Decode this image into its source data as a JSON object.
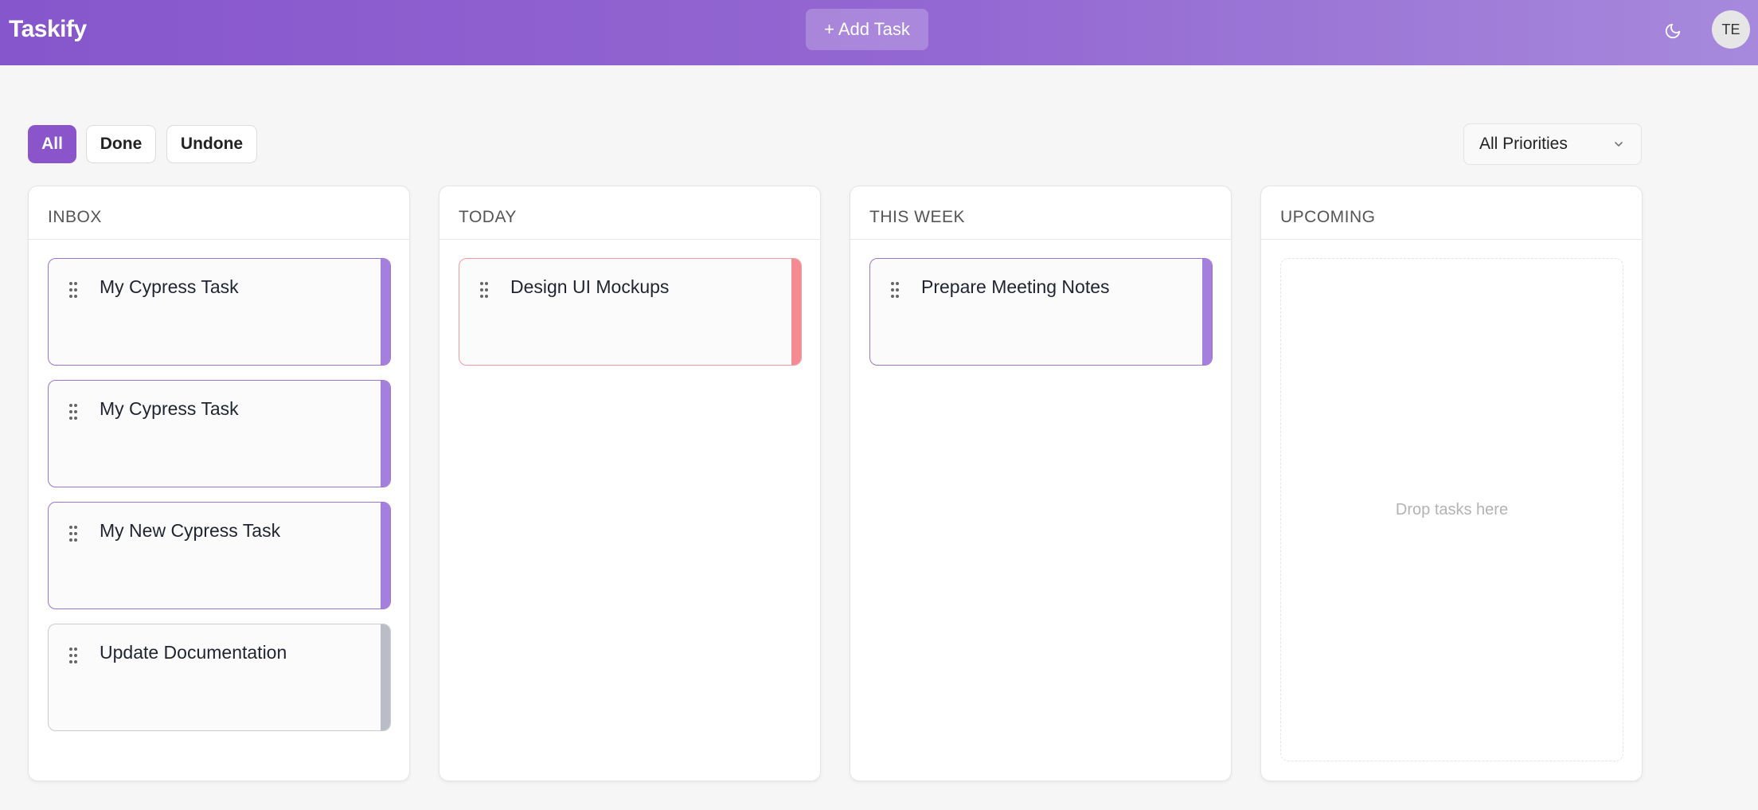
{
  "app": {
    "brand": "Taskify",
    "add_task_label": "+ Add Task",
    "avatar_initials": "TE"
  },
  "filters": {
    "all": "All",
    "done": "Done",
    "undone": "Undone",
    "active": "All"
  },
  "priority_select": {
    "value": "All Priorities"
  },
  "colors": {
    "accent": "#8a55cb",
    "priority_purple": "#a57fdc",
    "priority_red": "#f58b92",
    "priority_gray": "#b9bdc6"
  },
  "columns": [
    {
      "title": "INBOX",
      "tasks": [
        {
          "title": "My Cypress Task",
          "priority_color": "purple"
        },
        {
          "title": "My Cypress Task",
          "priority_color": "purple"
        },
        {
          "title": "My New Cypress Task",
          "priority_color": "purple"
        },
        {
          "title": "Update Documentation",
          "priority_color": "gray"
        }
      ]
    },
    {
      "title": "TODAY",
      "tasks": [
        {
          "title": "Design UI Mockups",
          "priority_color": "red"
        }
      ]
    },
    {
      "title": "THIS WEEK",
      "tasks": [
        {
          "title": "Prepare Meeting Notes",
          "priority_color": "purple"
        }
      ]
    },
    {
      "title": "UPCOMING",
      "tasks": [],
      "empty_text": "Drop tasks here"
    }
  ]
}
